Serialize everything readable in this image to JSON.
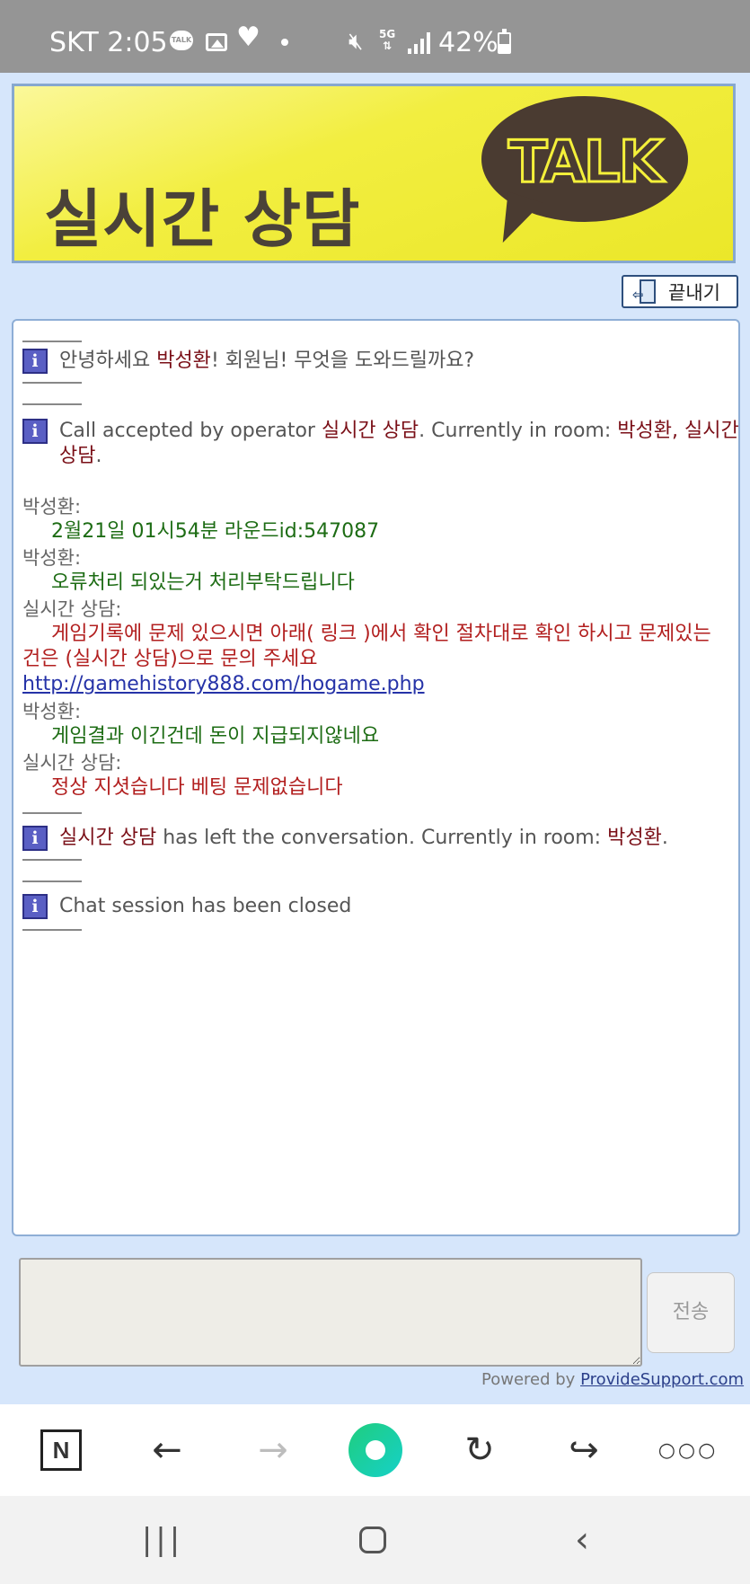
{
  "status_bar": {
    "carrier_time": "SKT 2:05",
    "talk_badge": "TALK",
    "network": "5G",
    "battery": "42%"
  },
  "banner": {
    "title": "실시간 상담",
    "logo_text": "TALK"
  },
  "end_button": {
    "label": "끝내기"
  },
  "chat": {
    "system_1": {
      "pre": "안녕하세요 ",
      "name": "박성환",
      "post": "! 회원님! 무엇을 도와드릴까요?"
    },
    "system_2": {
      "pre": "Call accepted by operator ",
      "operator": "실시간 상담",
      "mid": ". Currently in room: ",
      "room": "박성환, 실시간 상담",
      "post": "."
    },
    "messages": [
      {
        "author": "박성환:",
        "text": "2월21일 01시54분  라운드id:547087"
      },
      {
        "author": "박성환:",
        "text": "오류처리 되있는거 처리부탁드립니다"
      },
      {
        "author": "실시간 상담:",
        "text": "게임기록에 문제 있으시면 아래( 링크 )에서 확인 절차대로 확인 하시고 문제있는 건은 (실시간 상담)으로 문의 주세요",
        "link": "http://gamehistory888.com/hogame.php"
      },
      {
        "author": "박성환:",
        "text": "게임결과 이긴건데 돈이 지급되지않네요"
      },
      {
        "author": "실시간 상담:",
        "text": "정상 지셧습니다 베팅 문제없습니다"
      }
    ],
    "system_3": {
      "operator": "실시간 상담",
      "mid": " has left the conversation. Currently in room: ",
      "room": "박성환",
      "post": "."
    },
    "system_4": {
      "text": "Chat session has been closed"
    }
  },
  "input": {
    "value": ""
  },
  "send_button": {
    "label": "전송"
  },
  "powered": {
    "prefix": "Powered by ",
    "link": "ProvideSupport.com"
  },
  "browser_bar": {
    "n_label": "N"
  },
  "colors": {
    "banner_yellow": "#f2ee40",
    "chat_border": "#8eaed6",
    "user_text": "#1d6c14",
    "operator_text": "#b21f1f",
    "name_text": "#7a0f17",
    "info_icon": "#5a5fc4",
    "home_green": "#1fce7e"
  }
}
